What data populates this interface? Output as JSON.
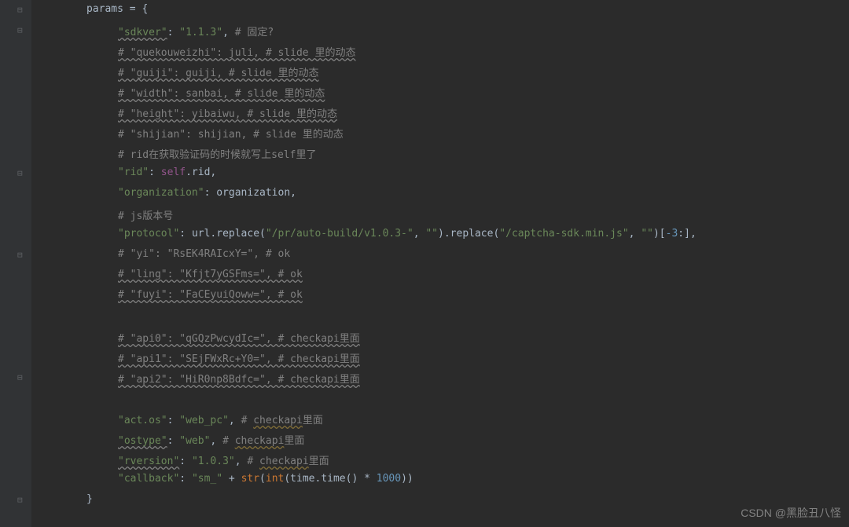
{
  "code": {
    "l01_a": "params ",
    "l01_b": "= {",
    "l02_key": "\"sdkver\"",
    "l02_sep": ": ",
    "l02_val": "\"1.1.3\"",
    "l02_comma": ",  ",
    "l02_cmt": "# 固定?",
    "l03": "# \"quekouweizhi\": juli,  # slide 里的动态",
    "l04": "# \"guiji\": guiji,  # slide 里的动态",
    "l05": "# \"width\": sanbai,  # slide 里的动态",
    "l06": "# \"height\": yibaiwu,  # slide 里的动态",
    "l07": "# \"shijian\": shijian,  # slide 里的动态",
    "l08": "# rid在获取验证码的时候就写上self里了",
    "l09_key": "\"rid\"",
    "l09_sep": ": ",
    "l09_self": "self",
    "l09_rest": ".rid,",
    "l10_key": "\"organization\"",
    "l10_sep": ": ",
    "l10_val": "organization",
    "l10_comma": ",",
    "l11": "# js版本号",
    "l12_key": "\"protocol\"",
    "l12_sep": ": ",
    "l12_a": "url.replace(",
    "l12_s1": "\"/pr/auto-build/v1.0.3-\"",
    "l12_c1": ", ",
    "l12_s2": "\"\"",
    "l12_b": ").replace(",
    "l12_s3": "\"/captcha-sdk.min.js\"",
    "l12_c2": ", ",
    "l12_s4": "\"\"",
    "l12_c": ")[",
    "l12_n1": "-3",
    "l12_d": ":],",
    "l13": "# \"yi\": \"RsEK4RAIcxY=\",  # ok",
    "l14": "# \"ling\": \"Kfjt7yGSFms=\",  # ok",
    "l15": "# \"fuyi\": \"FaCEyuiQoww=\",  # ok",
    "l16": "",
    "l17": "# \"api0\": \"qGQzPwcydIc=\",  # checkapi里面",
    "l18": "# \"api1\": \"SEjFWxRc+Y0=\",  # checkapi里面",
    "l19": "# \"api2\": \"HiR0np8Bdfс=\",  # checkapi里面",
    "l20": "",
    "l21_key": "\"act.os\"",
    "l21_sep": ": ",
    "l21_val": "\"web_pc\"",
    "l21_comma": ",  ",
    "l21_cmt_a": "# ",
    "l21_cmt_b": "checkapi",
    "l21_cmt_c": "里面",
    "l22_key": "\"ostype\"",
    "l22_sep": ": ",
    "l22_val": "\"web\"",
    "l22_comma": ",  ",
    "l22_cmt_a": "# ",
    "l22_cmt_b": "checkapi",
    "l22_cmt_c": "里面",
    "l23_key": "\"rversion\"",
    "l23_sep": ": ",
    "l23_val": "\"1.0.3\"",
    "l23_comma": ",  ",
    "l23_cmt_a": "# ",
    "l23_cmt_b": "checkapi",
    "l23_cmt_c": "里面",
    "l24_key": "\"callback\"",
    "l24_sep": ": ",
    "l24_val": "\"sm_\"",
    "l24_plus": " + ",
    "l24_str": "str",
    "l24_p1": "(",
    "l24_int": "int",
    "l24_p2": "(time.time() * ",
    "l24_num": "1000",
    "l24_p3": "))",
    "l25": "}"
  },
  "watermark": "CSDN @黑脸丑八怪"
}
